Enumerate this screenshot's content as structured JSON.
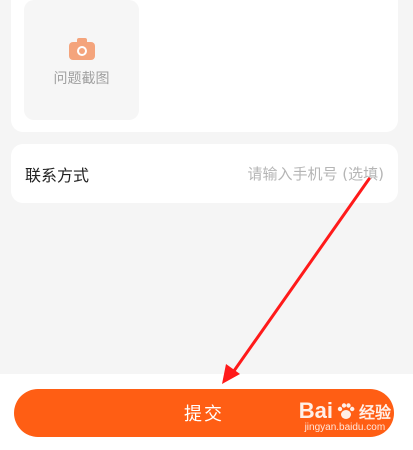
{
  "screenshot_section": {
    "upload_label": "问题截图",
    "icon": "camera-icon",
    "icon_color": "#f4a47c"
  },
  "contact": {
    "label": "联系方式",
    "placeholder": "请输入手机号 (选填)",
    "value": ""
  },
  "submit": {
    "label": "提交",
    "color": "#ff5e14"
  },
  "annotation": {
    "arrow_color": "#ff1a1a"
  },
  "watermark": {
    "logo": "Bai",
    "logo_icon": "paw-icon",
    "suffix": "经验",
    "url": "jingyan.baidu.com"
  }
}
